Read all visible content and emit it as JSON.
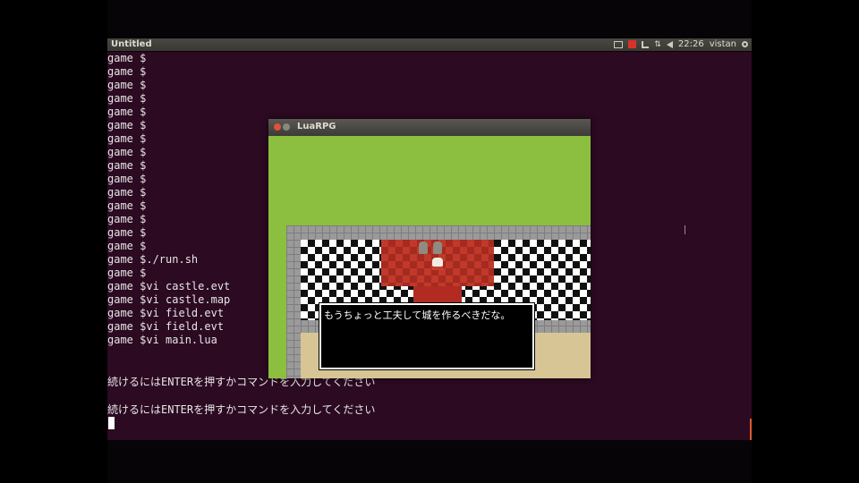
{
  "panel": {
    "window_title": "Untitled",
    "clock": "22:26",
    "user": "vistan"
  },
  "terminal": {
    "lines": [
      "game $",
      "game $",
      "game $",
      "game $",
      "game $",
      "game $",
      "game $",
      "game $",
      "game $",
      "game $",
      "game $",
      "game $",
      "game $",
      "game $",
      "game $",
      "game $./run.sh",
      "game $",
      "game $vi castle.evt",
      "game $vi castle.map",
      "game $vi field.evt",
      "game $vi field.evt",
      "game $vi main.lua",
      "続けるにはENTERを押すかコマンドを入力してください",
      "続けるにはENTERを押すかコマンドを入力してください"
    ]
  },
  "game_window": {
    "title": "LuaRPG",
    "dialog_text": "もうちょっと工夫して城を作るべきだな。"
  },
  "colors": {
    "terminal_bg": "#2c0a22",
    "panel_bg": "#3c3b37",
    "grass": "#8cbf3f",
    "carpet": "#c0392b",
    "accent_orange": "#e2572a"
  },
  "icons": [
    "mail-icon",
    "record-icon",
    "network-icon",
    "transfer-icon",
    "volume-icon",
    "gear-icon"
  ]
}
